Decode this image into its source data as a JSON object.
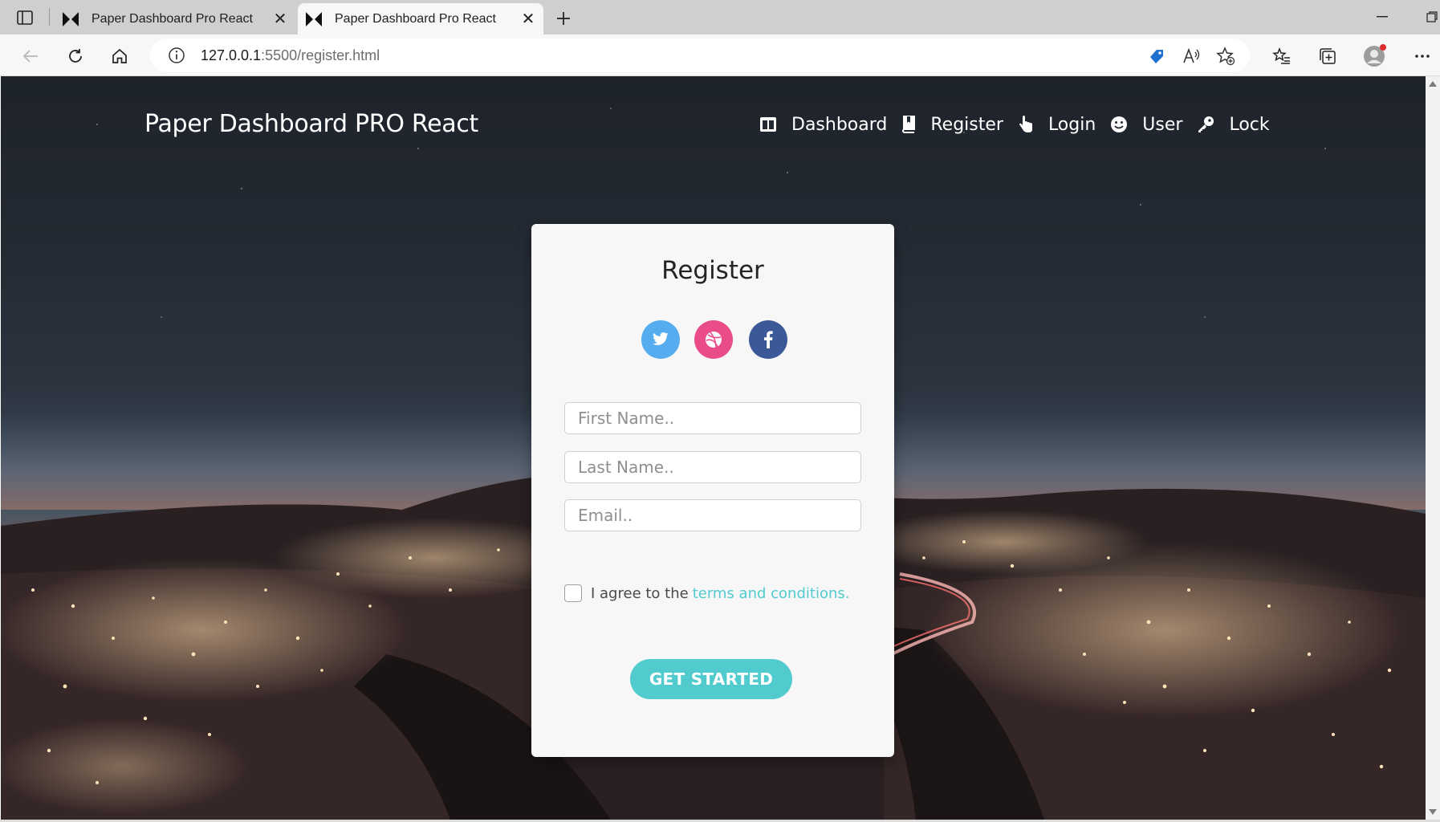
{
  "browser": {
    "tabs": [
      {
        "title": "Paper Dashboard Pro React",
        "active": false
      },
      {
        "title": "Paper Dashboard Pro React",
        "active": true
      }
    ],
    "url_host": "127.0.0.1",
    "url_rest": ":5500/register.html"
  },
  "page": {
    "brand": "Paper Dashboard PRO React",
    "nav": [
      {
        "label": "Dashboard",
        "icon": "layout-icon"
      },
      {
        "label": "Register",
        "icon": "book-bookmark-icon"
      },
      {
        "label": "Login",
        "icon": "hand-pointer-icon"
      },
      {
        "label": "User",
        "icon": "smile-face-icon"
      },
      {
        "label": "Lock",
        "icon": "key-icon"
      }
    ]
  },
  "card": {
    "title": "Register",
    "social": [
      "twitter-icon",
      "dribbble-icon",
      "facebook-icon"
    ],
    "first_name_placeholder": "First Name..",
    "last_name_placeholder": "Last Name..",
    "email_placeholder": "Email..",
    "agree_text": "I agree to the",
    "terms_link": "terms and conditions.",
    "submit_label": "GET STARTED"
  },
  "colors": {
    "accent": "#51cbce",
    "twitter": "#55acee",
    "dribbble": "#ea4c89",
    "facebook": "#3b5998"
  }
}
